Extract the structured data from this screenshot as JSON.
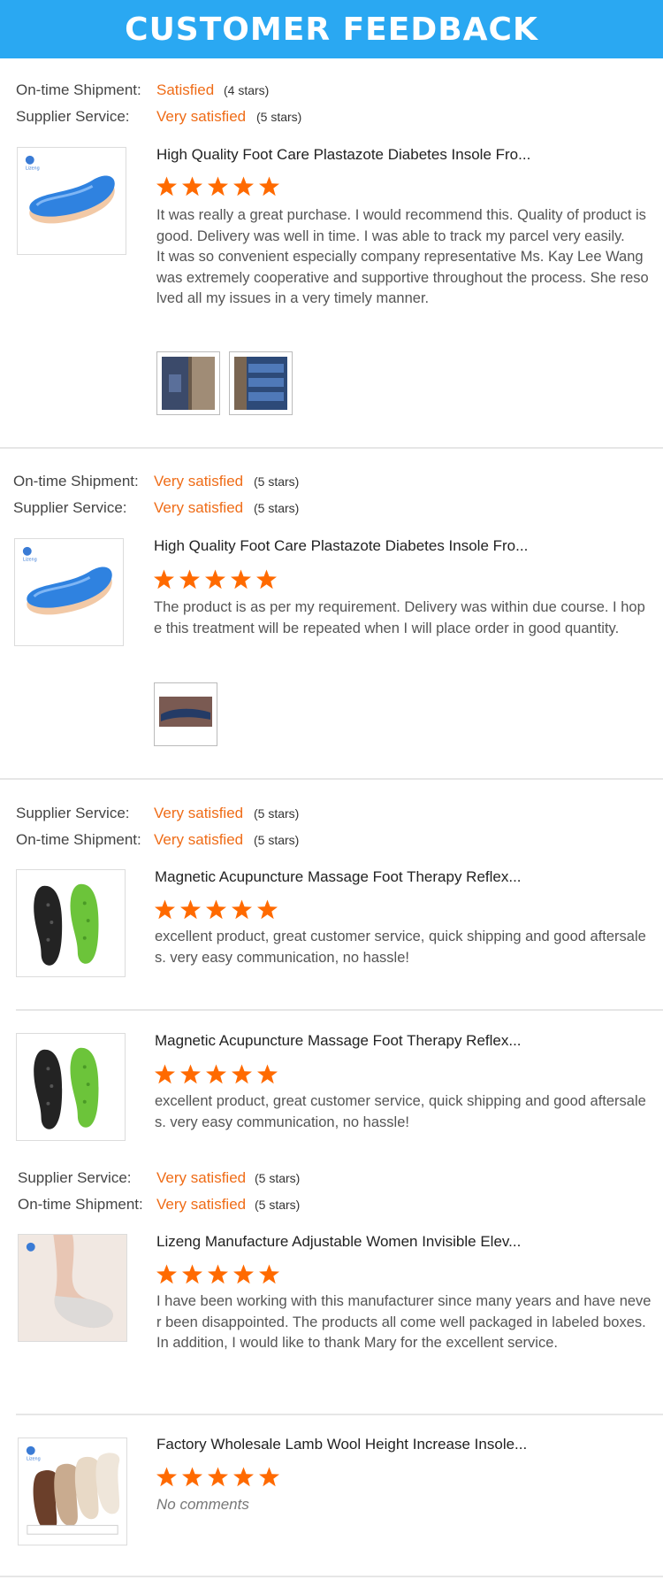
{
  "header": {
    "title": "CUSTOMER FEEDBACK"
  },
  "colors": {
    "header_bg": "#2aa8f2",
    "accent": "#ef6c17",
    "star": "#ff6a00"
  },
  "reviews": [
    {
      "ratings": [
        {
          "label": "On-time Shipment:",
          "value": "Satisfied",
          "stars": "(4 stars)"
        },
        {
          "label": "Supplier Service:",
          "value": "Very satisfied",
          "stars": "(5 stars)"
        }
      ],
      "product": "High Quality Foot Care Plastazote Diabetes Insole Fro...",
      "star_count": 5,
      "paragraphs": [
        "It was really a great purchase. I would recommend this. Quality of product is good. Delivery was well in time. I was able to track my parcel very easily.",
        "It was so convenient especially company representative Ms. Kay Lee Wang was extremely cooperative and supportive throughout the process. She resolved all my issues in a very timely manner."
      ],
      "photos": 2
    },
    {
      "ratings": [
        {
          "label": "On-time Shipment:",
          "value": "Very satisfied",
          "stars": "(5 stars)"
        },
        {
          "label": "Supplier Service:",
          "value": "Very satisfied",
          "stars": "(5 stars)"
        }
      ],
      "product": "High Quality Foot Care Plastazote Diabetes Insole Fro...",
      "star_count": 5,
      "paragraphs": [
        "The product is as per my requirement. Delivery was within due course. I hope this treatment will be repeated when I will place order in good quantity."
      ],
      "photos": 1
    },
    {
      "ratings": [
        {
          "label": "Supplier Service:",
          "value": "Very satisfied",
          "stars": "(5 stars)"
        },
        {
          "label": "On-time Shipment:",
          "value": "Very satisfied",
          "stars": "(5 stars)"
        }
      ],
      "product": "Magnetic Acupuncture Massage Foot Therapy Reflex...",
      "star_count": 5,
      "paragraphs": [
        "excellent product, great customer service, quick shipping and good aftersales. very easy communication, no hassle!"
      ]
    },
    {
      "product": "Magnetic Acupuncture Massage Foot Therapy Reflex...",
      "star_count": 5,
      "paragraphs": [
        "excellent product, great customer service, quick shipping and good aftersales. very easy communication, no hassle!"
      ]
    },
    {
      "ratings": [
        {
          "label": "Supplier Service:",
          "value": "Very satisfied",
          "stars": "(5 stars)"
        },
        {
          "label": "On-time Shipment:",
          "value": "Very satisfied",
          "stars": "(5 stars)"
        }
      ],
      "product": "Lizeng Manufacture Adjustable Women Invisible Elev...",
      "star_count": 5,
      "paragraphs": [
        "I have been working with this manufacturer since many years and have never been disappointed. The products all come well packaged in labeled boxes.",
        "In addition, I would like to thank Mary for the excellent service."
      ]
    },
    {
      "product": "Factory Wholesale Lamb Wool Height Increase Insole...",
      "star_count": 5,
      "no_comment": "No comments"
    }
  ]
}
